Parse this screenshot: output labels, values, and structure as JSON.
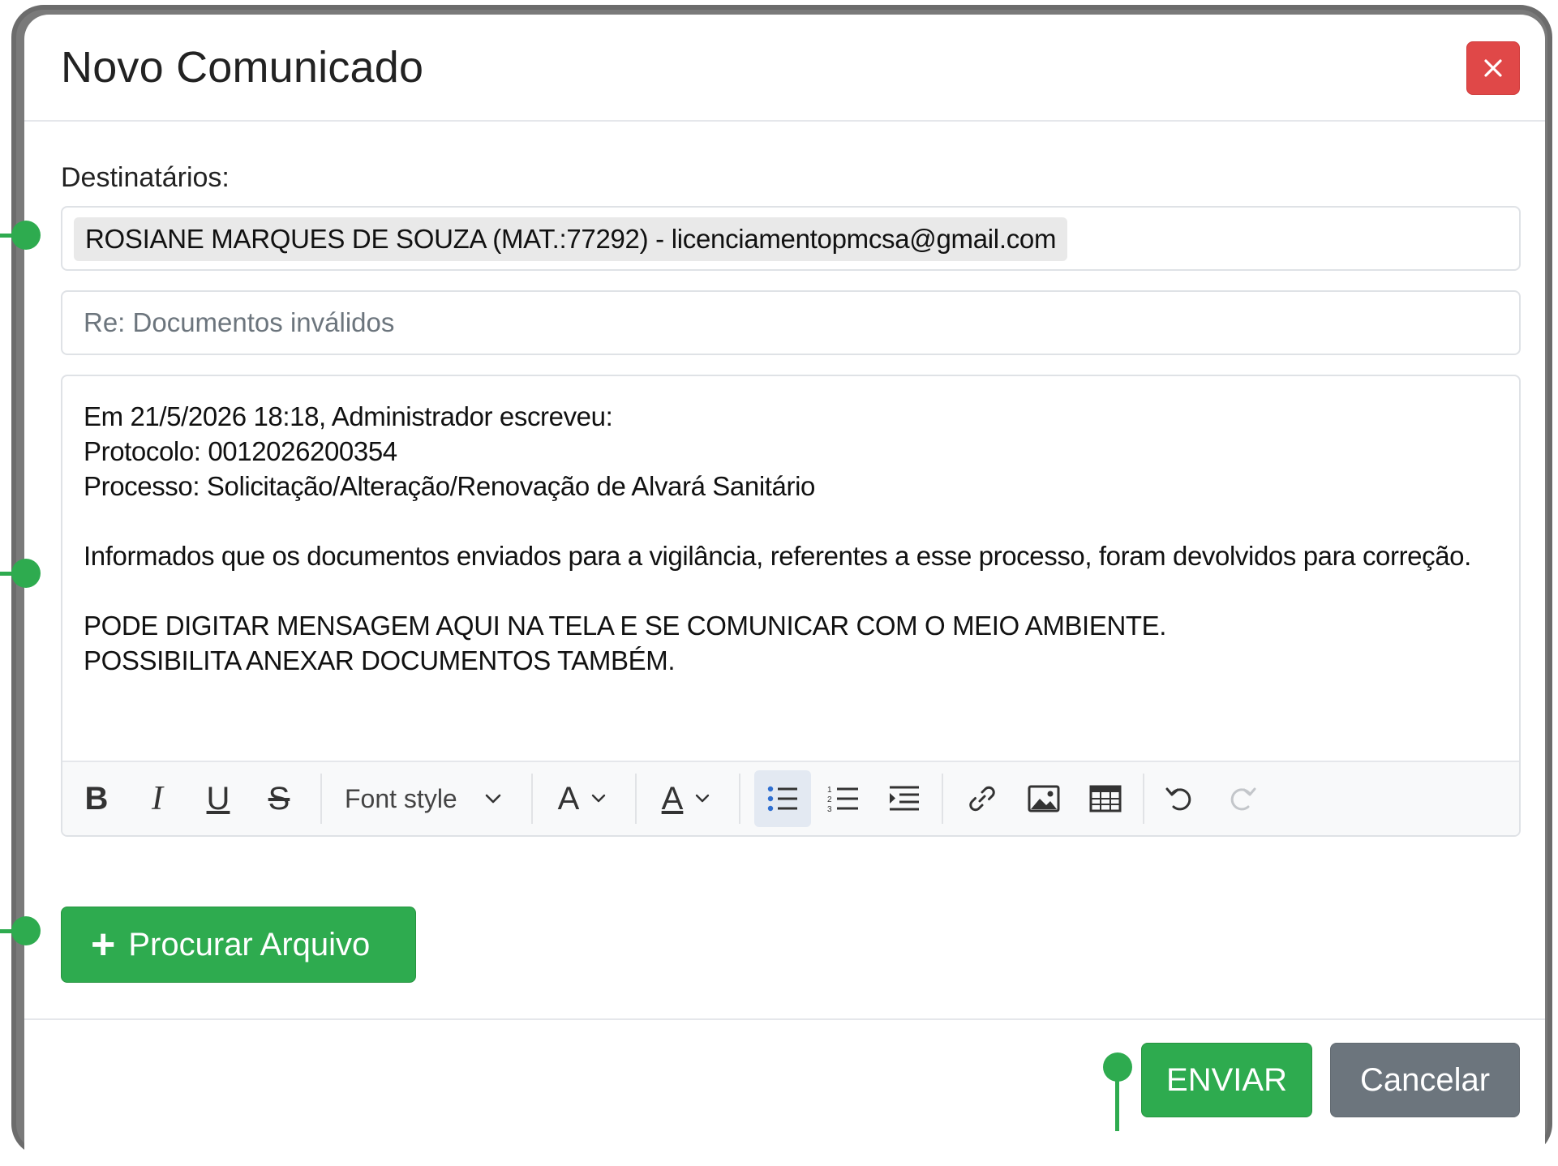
{
  "modal": {
    "title": "Novo Comunicado",
    "close_icon": "close-icon"
  },
  "recipients": {
    "label": "Destinatários:",
    "items": [
      {
        "text": "ROSIANE MARQUES DE SOUZA (MAT.:77292) - licenciamentopmcsa@gmail.com"
      }
    ]
  },
  "subject": {
    "placeholder": "Re: Documentos inválidos",
    "value": ""
  },
  "editor": {
    "lines": [
      "Em 21/5/2026 18:18, Administrador escreveu:",
      "Protocolo: 0012026200354",
      "Processo: Solicitação/Alteração/Renovação de Alvará Sanitário",
      "",
      "Informados que os documentos enviados para a vigilância, referentes a esse processo, foram devolvidos para correção.",
      "",
      "PODE DIGITAR MENSAGEM AQUI NA TELA E SE COMUNICAR COM O MEIO AMBIENTE.",
      "POSSIBILITA ANEXAR DOCUMENTOS TAMBÉM."
    ],
    "toolbar": {
      "bold": "B",
      "italic": "I",
      "underline": "U",
      "strikethrough": "S",
      "font_style": "Font style",
      "font_size_glyph": "A",
      "font_color_glyph": "A",
      "active_tool": "bullet-list"
    }
  },
  "upload": {
    "label": "Procurar Arquivo",
    "icon": "plus-icon"
  },
  "footer": {
    "send_label": "ENVIAR",
    "cancel_label": "Cancelar"
  },
  "colors": {
    "success": "#2eab4f",
    "danger": "#e04848",
    "secondary": "#6c757d",
    "annotation": "#2eab4f"
  }
}
